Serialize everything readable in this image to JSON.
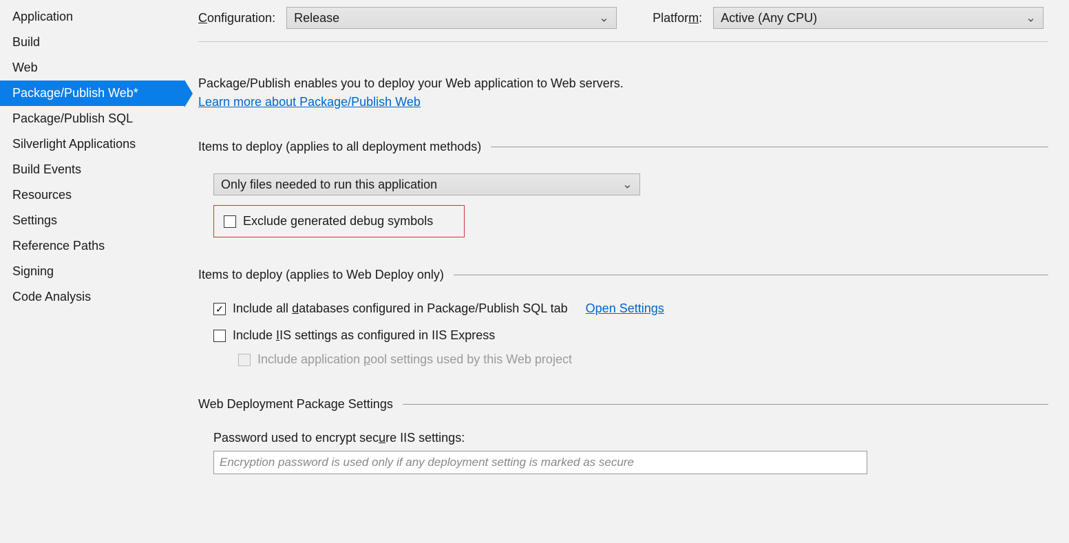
{
  "sidebar": {
    "items": [
      {
        "label": "Application"
      },
      {
        "label": "Build"
      },
      {
        "label": "Web"
      },
      {
        "label": "Package/Publish Web*"
      },
      {
        "label": "Package/Publish SQL"
      },
      {
        "label": "Silverlight Applications"
      },
      {
        "label": "Build Events"
      },
      {
        "label": "Resources"
      },
      {
        "label": "Settings"
      },
      {
        "label": "Reference Paths"
      },
      {
        "label": "Signing"
      },
      {
        "label": "Code Analysis"
      }
    ],
    "selected_index": 3
  },
  "config_bar": {
    "configuration_label": "Configuration:",
    "configuration_value": "Release",
    "platform_label": "Platform:",
    "platform_value": "Active (Any CPU)"
  },
  "main": {
    "intro": "Package/Publish enables you to deploy your Web application to Web servers.",
    "learn_more": "Learn more about Package/Publish Web",
    "section1_title": "Items to deploy (applies to all deployment methods)",
    "deploy_mode": "Only files needed to run this application",
    "exclude_debug": "Exclude generated debug symbols",
    "section2_title": "Items to deploy (applies to Web Deploy only)",
    "include_db": "Include all databases configured in Package/Publish SQL tab",
    "open_settings": "Open Settings",
    "include_iis": "Include IIS settings as configured in IIS Express",
    "include_apppool": "Include application pool settings used by this Web project",
    "section3_title": "Web Deployment Package Settings",
    "password_label": "Password used to encrypt secure IIS settings:",
    "password_placeholder": "Encryption password is used only if any deployment setting is marked as secure"
  }
}
